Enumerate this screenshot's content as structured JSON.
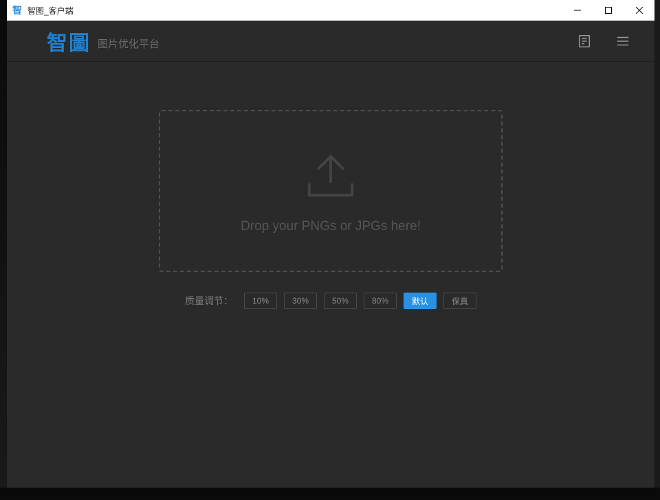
{
  "window": {
    "icon_char": "智",
    "title": "智图_客户端"
  },
  "header": {
    "logo": "智圖",
    "subtitle": "图片优化平台"
  },
  "dropzone": {
    "text": "Drop your PNGs or JPGs here!"
  },
  "quality": {
    "label": "质量调节：",
    "options": [
      {
        "label": "10%",
        "active": false
      },
      {
        "label": "30%",
        "active": false
      },
      {
        "label": "50%",
        "active": false
      },
      {
        "label": "80%",
        "active": false
      },
      {
        "label": "默认",
        "active": true
      },
      {
        "label": "保真",
        "active": false
      }
    ]
  }
}
